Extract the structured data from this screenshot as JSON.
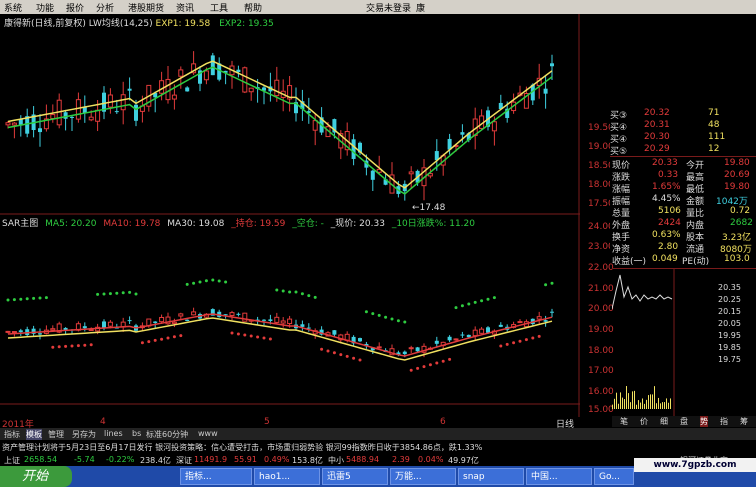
{
  "menu": {
    "items": [
      "系统",
      "功能",
      "报价",
      "分析",
      "港股期货",
      "资讯",
      "工具",
      "帮助"
    ],
    "right_text": "交易未登录",
    "right_extra": "康"
  },
  "main_title": {
    "name": "康得新(日线,前复权)",
    "indicator": "LW均线(14,25)",
    "exp1": "EXP1: 19.58",
    "exp2": "EXP2: 19.35"
  },
  "sar_legend": {
    "title": "SAR主图",
    "ma5": "MA5: 20.20",
    "ma10": "MA10: 19.78",
    "ma30": "MA30: 19.08",
    "buy": "_持仓: 19.59",
    "empty": "_空仓: -",
    "price": "_现价: 20.33",
    "change10": "_10日涨跌%: 11.20"
  },
  "low_marker": "←17.48",
  "upper_axis": [
    "19.50",
    "19.00",
    "18.50",
    "18.00",
    "17.50"
  ],
  "lower_axis": [
    "24.00",
    "23.00",
    "22.00",
    "21.00",
    "20.00",
    "19.00",
    "18.00",
    "17.00",
    "16.00",
    "15.00"
  ],
  "bottom_ruler": {
    "year": "2011年",
    "m4": "4",
    "m5": "5",
    "m6": "6",
    "unit": "日线"
  },
  "quote": {
    "asks": [
      {
        "label": "买③",
        "price": "20.32",
        "vol": "71"
      },
      {
        "label": "买④",
        "price": "20.31",
        "vol": "48"
      },
      {
        "label": "买④",
        "price": "20.30",
        "vol": "111"
      },
      {
        "label": "买⑤",
        "price": "20.29",
        "vol": "12"
      }
    ],
    "stats": [
      {
        "l1": "现价",
        "v1": "20.33",
        "l2": "今开",
        "v2": "19.80"
      },
      {
        "l1": "涨跌",
        "v1": "0.33",
        "l2": "最高",
        "v2": "20.69"
      },
      {
        "l1": "涨幅",
        "v1": "1.65%",
        "l2": "最低",
        "v2": "19.80"
      },
      {
        "l1": "振幅",
        "v1": "4.45%",
        "l2": "金额",
        "v2": "1042万"
      },
      {
        "l1": "总量",
        "v1": "5106",
        "l2": "量比",
        "v2": "0.72"
      },
      {
        "l1": "外盘",
        "v1": "2424",
        "l2": "内盘",
        "v2": "2682"
      },
      {
        "l1": "换手",
        "v1": "0.63%",
        "l2": "股本",
        "v2": "3.23亿"
      },
      {
        "l1": "净资",
        "v1": "2.80",
        "l2": "流通",
        "v2": "8080万"
      },
      {
        "l1": "收益(一)",
        "v1": "0.049",
        "l2": "PE(动)",
        "v2": "103.0"
      }
    ]
  },
  "mini_axis": [
    "20.35",
    "20.25",
    "20.15",
    "20.05",
    "19.95",
    "19.85",
    "19.75"
  ],
  "mini_tabs": [
    "笔",
    "价",
    "细",
    "盘",
    "势",
    "指",
    "筹"
  ],
  "tabs": [
    "指标",
    "模板",
    "管理",
    "另存为",
    "lines",
    "bs",
    "标准60分钟",
    "www"
  ],
  "news": "资产管理计划将于5月23日至6月17日发行  银河投资策略：信心遭受打击，市场重归弱势验   银河99指数昨日收于3854.86点，跌1.33%",
  "indices": [
    {
      "name": "上证",
      "value": "2658.54",
      "chg": "-5.74",
      "pct": "-0.22%",
      "amt": "238.4亿"
    },
    {
      "name": "深证",
      "value": "11491.9",
      "chg": "55.91",
      "pct": "0.49%",
      "amt": "153.8亿"
    },
    {
      "name": "中小",
      "value": "5488.94",
      "chg": "2.39",
      "pct": "0.04%",
      "amt": "49.97亿"
    }
  ],
  "index_right": "银河证券北京",
  "taskbar": {
    "start": "开始",
    "items": [
      "指标...",
      "hao1...",
      "迅雷5",
      "万能...",
      "snap",
      "中国...",
      "Go..."
    ]
  },
  "watermark": "www.7gpzb.com",
  "chart_data": {
    "type": "candlestick",
    "upper": {
      "title": "康得新(日线,前复权)",
      "series": [
        {
          "name": "EXP1",
          "last": 19.58
        },
        {
          "name": "EXP2",
          "last": 19.35
        }
      ],
      "ylim": [
        17.3,
        20.2
      ],
      "low_marker": 17.48
    },
    "lower": {
      "title": "SAR主图",
      "series": [
        {
          "name": "MA5",
          "last": 20.2
        },
        {
          "name": "MA10",
          "last": 19.78
        },
        {
          "name": "MA30",
          "last": 19.08
        }
      ],
      "ylim": [
        15.0,
        24.0
      ]
    },
    "colors": {
      "up": "#e23b3b",
      "down": "#3fd0e0",
      "exp1": "#f0e060",
      "exp2": "#2ecc40",
      "sar": "#2ecc40"
    }
  }
}
